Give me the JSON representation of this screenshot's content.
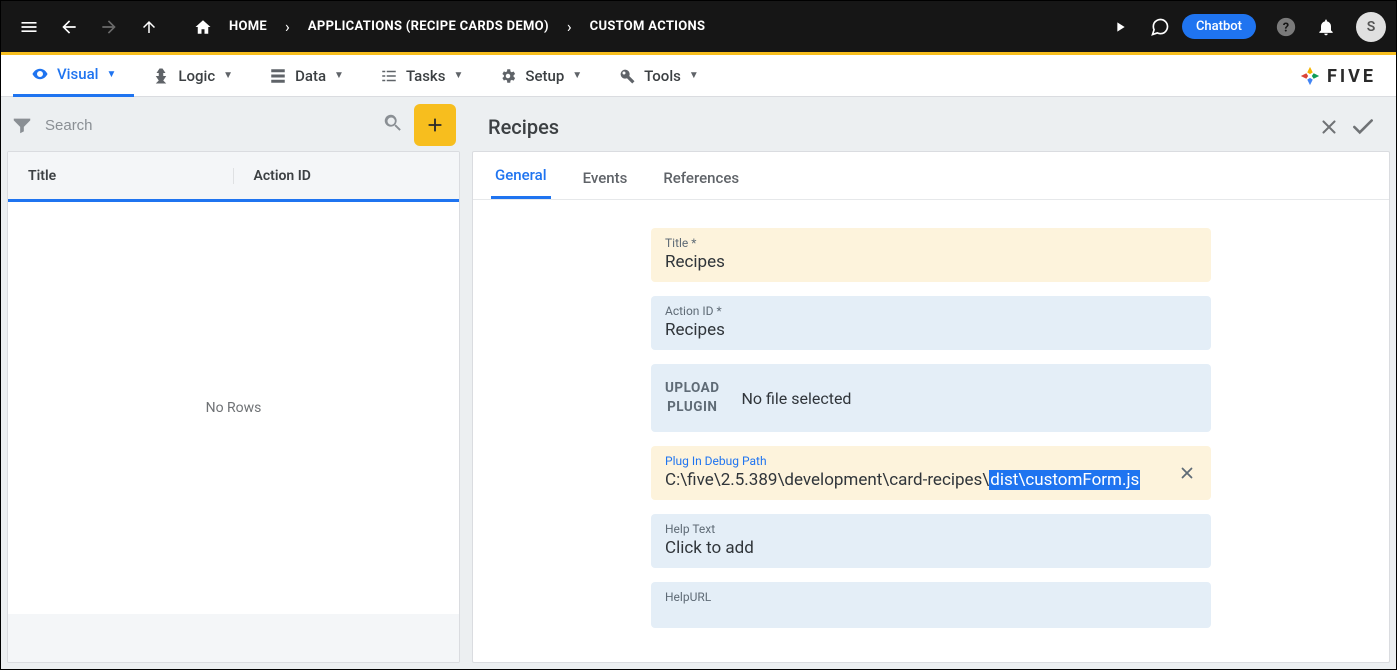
{
  "topbar": {
    "home": "HOME",
    "crumb_app": "APPLICATIONS (RECIPE CARDS DEMO)",
    "crumb_page": "CUSTOM ACTIONS",
    "chatbot": "Chatbot",
    "avatar_initial": "S"
  },
  "tabs": {
    "visual": "Visual",
    "logic": "Logic",
    "data": "Data",
    "tasks": "Tasks",
    "setup": "Setup",
    "tools": "Tools",
    "brand": "FIVE"
  },
  "left": {
    "search_placeholder": "Search",
    "col_title": "Title",
    "col_action": "Action ID",
    "empty": "No Rows"
  },
  "right": {
    "heading": "Recipes",
    "tabs": {
      "general": "General",
      "events": "Events",
      "references": "References"
    },
    "fields": {
      "title_label": "Title *",
      "title_value": "Recipes",
      "actionid_label": "Action ID *",
      "actionid_value": "Recipes",
      "upload_label_1": "UPLOAD",
      "upload_label_2": "PLUGIN",
      "upload_text": "No file selected",
      "debug_label": "Plug In Debug Path",
      "debug_prefix": "C:\\five\\2.5.389\\development\\card-recipes\\",
      "debug_selected": "dist\\customForm.js",
      "help_label": "Help Text",
      "help_value": "Click to add",
      "helpurl_label": "HelpURL",
      "helpurl_value": ""
    }
  }
}
